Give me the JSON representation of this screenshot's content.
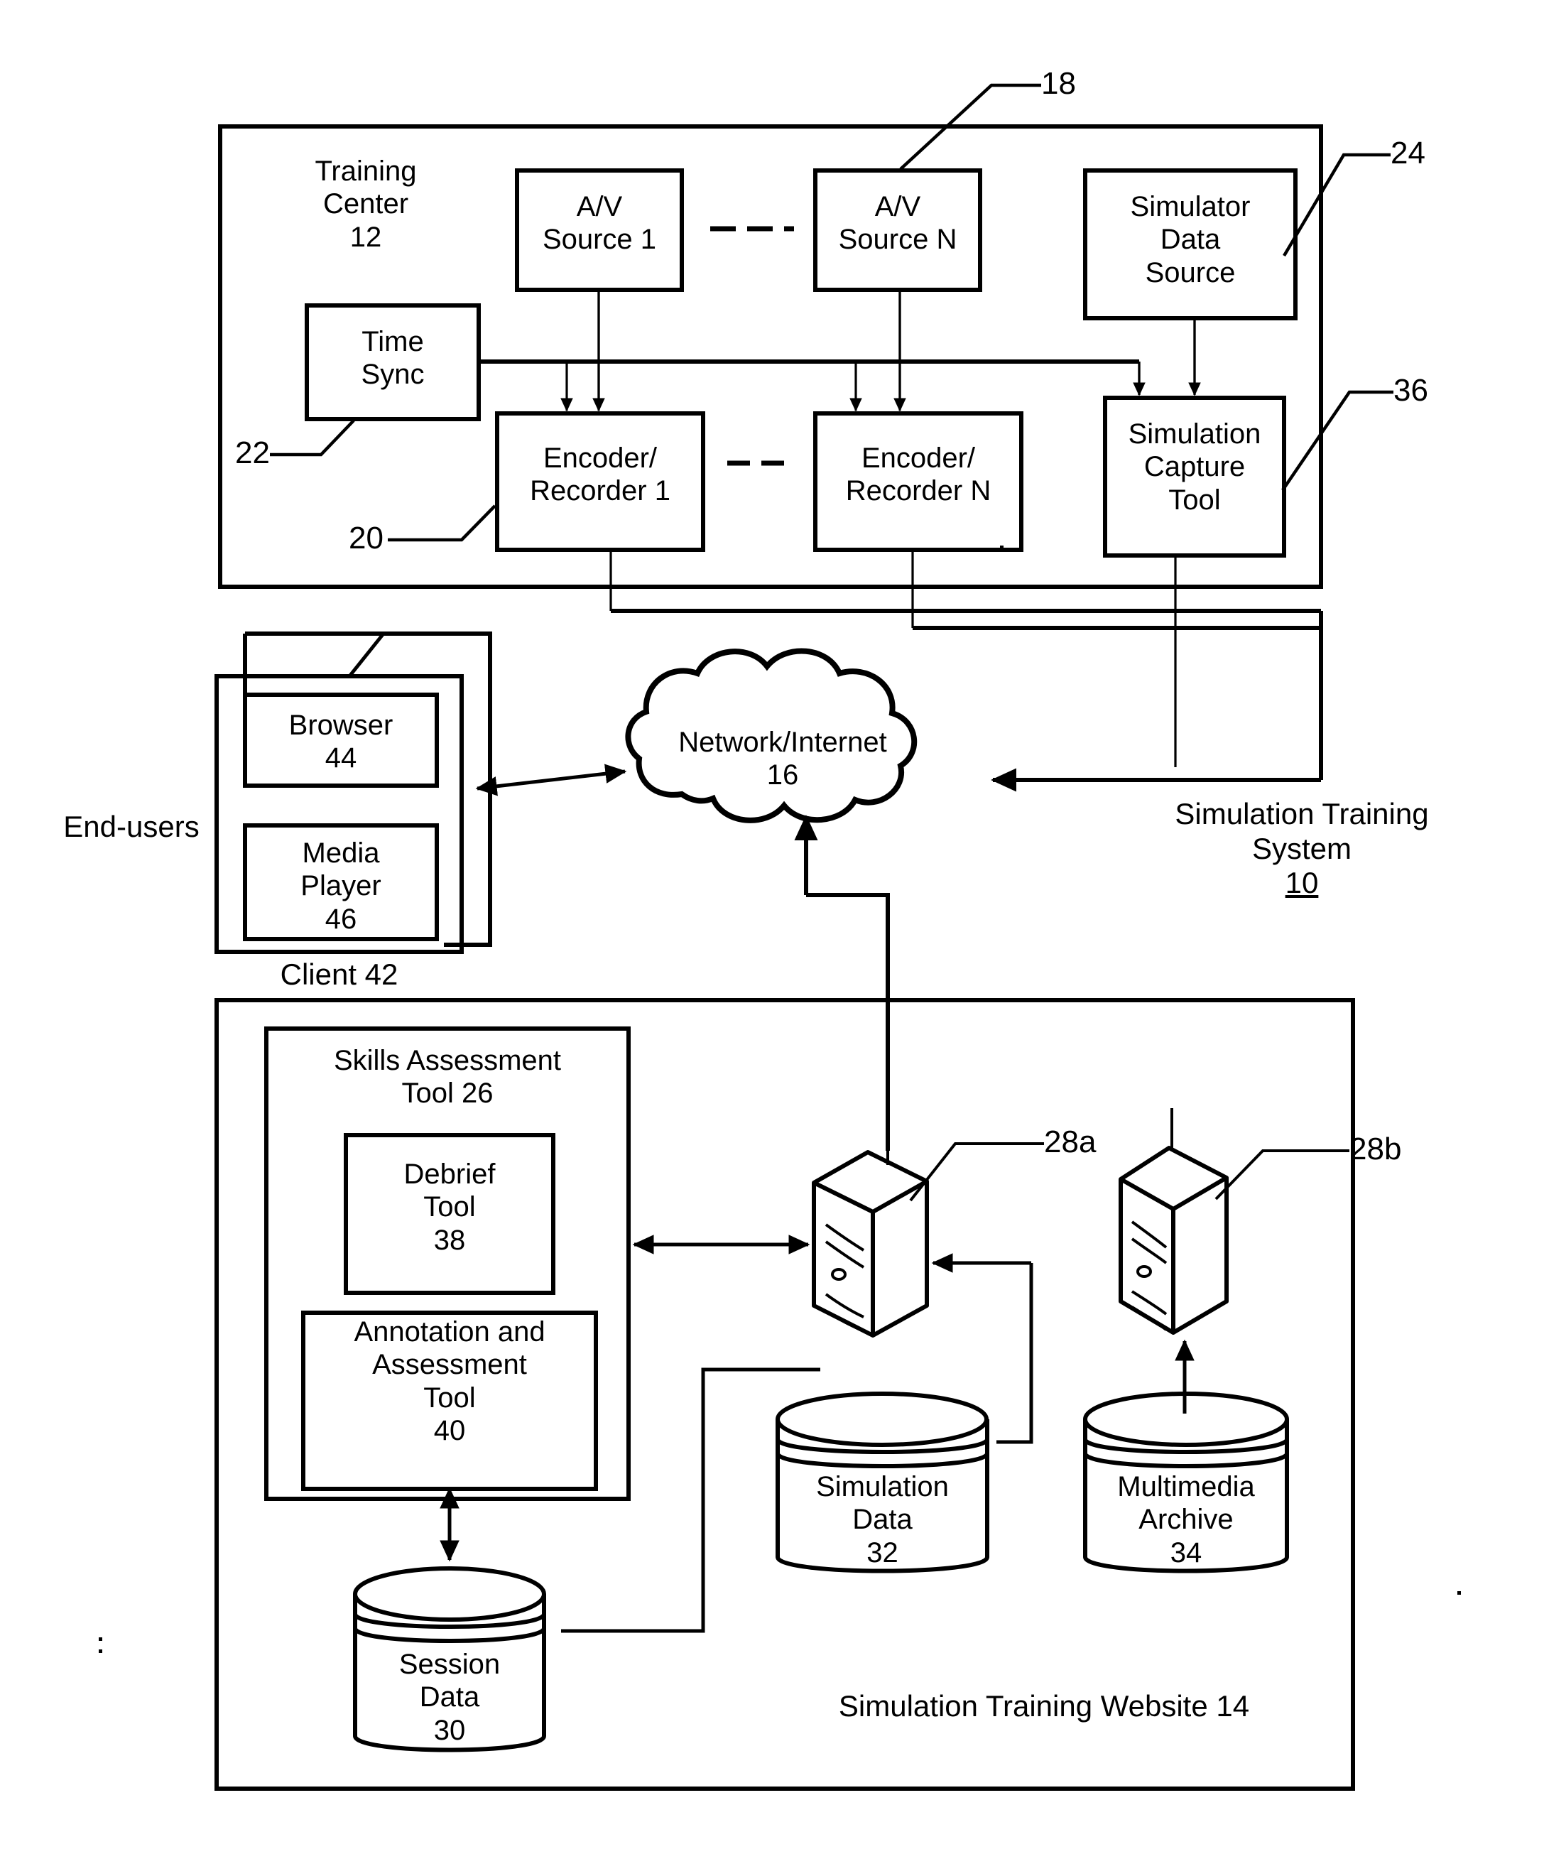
{
  "figure": {
    "type": "patent-block-diagram",
    "system_label": "Simulation Training System\n10",
    "system_label_name": "Simulation Training System",
    "system_ref": "10"
  },
  "training_center": {
    "title": "Training\nCenter\n12",
    "name": "Training Center",
    "ref": "12",
    "blocks": {
      "av_source_1": "A/V\nSource 1",
      "av_source_n": "A/V\nSource N",
      "simulator_data_source": "Simulator\nData\nSource",
      "time_sync": "Time\nSync",
      "encoder_recorder_1": "Encoder/\nRecorder 1",
      "encoder_recorder_n": "Encoder/\nRecorder N",
      "simulation_capture_tool": "Simulation\nCapture\nTool"
    },
    "refs": {
      "av_source": "18",
      "simulator_data_source": "24",
      "time_sync": "22",
      "encoder_recorder": "20",
      "simulation_capture_tool": "36"
    },
    "ellipsis": "- - - -"
  },
  "client": {
    "end_users_label": "End-users",
    "client_label": "Client 42",
    "browser": "Browser\n44",
    "media_player": "Media\nPlayer\n46"
  },
  "network": {
    "label": "Network/Internet\n16",
    "name": "Network/Internet",
    "ref": "16"
  },
  "website": {
    "footer_label": "Simulation Training Website 14",
    "name": "Simulation Training Website",
    "ref": "14",
    "skills_assessment_tool": "Skills Assessment\nTool  26",
    "debrief_tool": "Debrief\nTool\n38",
    "annotation_assessment_tool": "Annotation and\nAssessment\nTool\n40",
    "servers": {
      "server_a_ref": "28a",
      "server_b_ref": "28b"
    },
    "databases": {
      "session_data": "Session\nData\n30",
      "simulation_data": "Simulation\nData\n32",
      "multimedia_archive": "Multimedia\nArchive\n34"
    }
  },
  "colors": {
    "ink": "#000000",
    "paper": "#ffffff"
  }
}
